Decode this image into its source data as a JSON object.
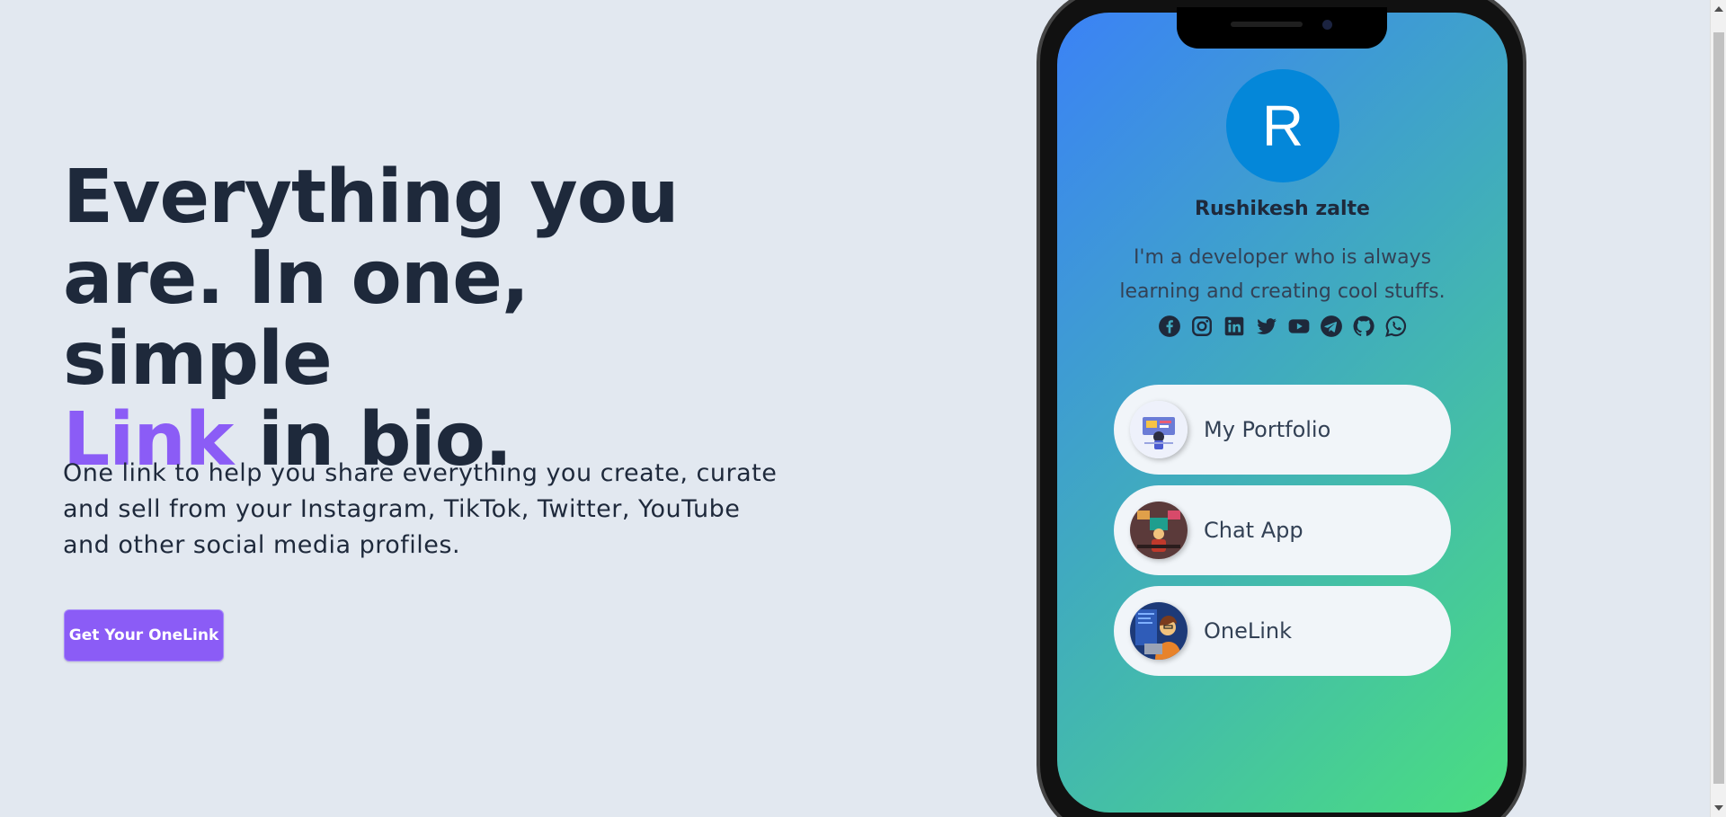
{
  "hero": {
    "title_line1": "Everything you",
    "title_line2": "are. In one, simple",
    "title_accent": "Link",
    "title_line3_rest": " in bio.",
    "subtitle": "One link to help you share everything you create, curate and sell from your Instagram, TikTok, Twitter, YouTube and other social media profiles.",
    "cta_label": "Get Your OneLink"
  },
  "profile": {
    "avatar_initial": "R",
    "name": "Rushikesh zalte",
    "bio": "I'm a developer who is always learning and creating cool stuffs.",
    "socials": [
      "facebook-icon",
      "instagram-icon",
      "linkedin-icon",
      "twitter-icon",
      "youtube-icon",
      "telegram-icon",
      "github-icon",
      "whatsapp-icon"
    ],
    "links": [
      {
        "label": "My Portfolio",
        "thumb": "portfolio-thumbnail"
      },
      {
        "label": "Chat App",
        "thumb": "chat-app-thumbnail"
      },
      {
        "label": "OneLink",
        "thumb": "onelink-thumbnail"
      }
    ]
  },
  "colors": {
    "background": "#e2e8f0",
    "text": "#1e293b",
    "accent": "#8b5cf6",
    "gradient_start": "#3b82f6",
    "gradient_end": "#4ade80",
    "avatar_bg": "#0487d9",
    "card_bg": "#f1f5f9"
  }
}
